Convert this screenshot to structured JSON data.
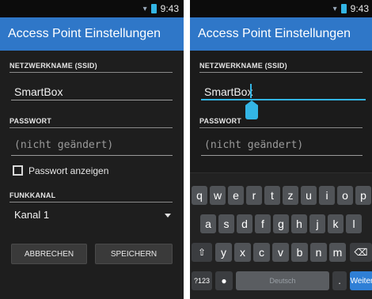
{
  "status": {
    "time": "9:43"
  },
  "left": {
    "title": "Access Point Einstellungen",
    "ssid_label": "NETZWERKNAME (SSID)",
    "ssid_value": "SmartBox",
    "password_label": "PASSWORT",
    "password_placeholder": "(nicht geändert)",
    "show_password_label": "Passwort anzeigen",
    "channel_label": "FUNKKANAL",
    "channel_value": "Kanal 1",
    "cancel_label": "ABBRECHEN",
    "save_label": "SPEICHERN"
  },
  "right": {
    "title": "Access Point Einstellungen",
    "ssid_label": "NETZWERKNAME (SSID)",
    "ssid_value": "SmartBox",
    "password_label": "PASSWORT",
    "password_placeholder": "(nicht geändert)",
    "keyboard": {
      "row1": [
        "q",
        "w",
        "e",
        "r",
        "t",
        "z",
        "u",
        "i",
        "o",
        "p"
      ],
      "row2": [
        "a",
        "s",
        "d",
        "f",
        "g",
        "h",
        "j",
        "k",
        "l"
      ],
      "row3": [
        "y",
        "x",
        "c",
        "v",
        "b",
        "n",
        "m"
      ],
      "symbols_key": "?123",
      "space_label": "Deutsch",
      "period_key": ".",
      "action_key": "Weiter"
    }
  },
  "colors": {
    "appbar": "#2f77c8",
    "accent": "#33b5e5",
    "background": "#1e1e1e"
  },
  "icons": {
    "wifi": "wifi-icon",
    "battery": "battery-icon",
    "shift": "shift-icon",
    "backspace": "backspace-icon",
    "mic": "mic-icon"
  }
}
